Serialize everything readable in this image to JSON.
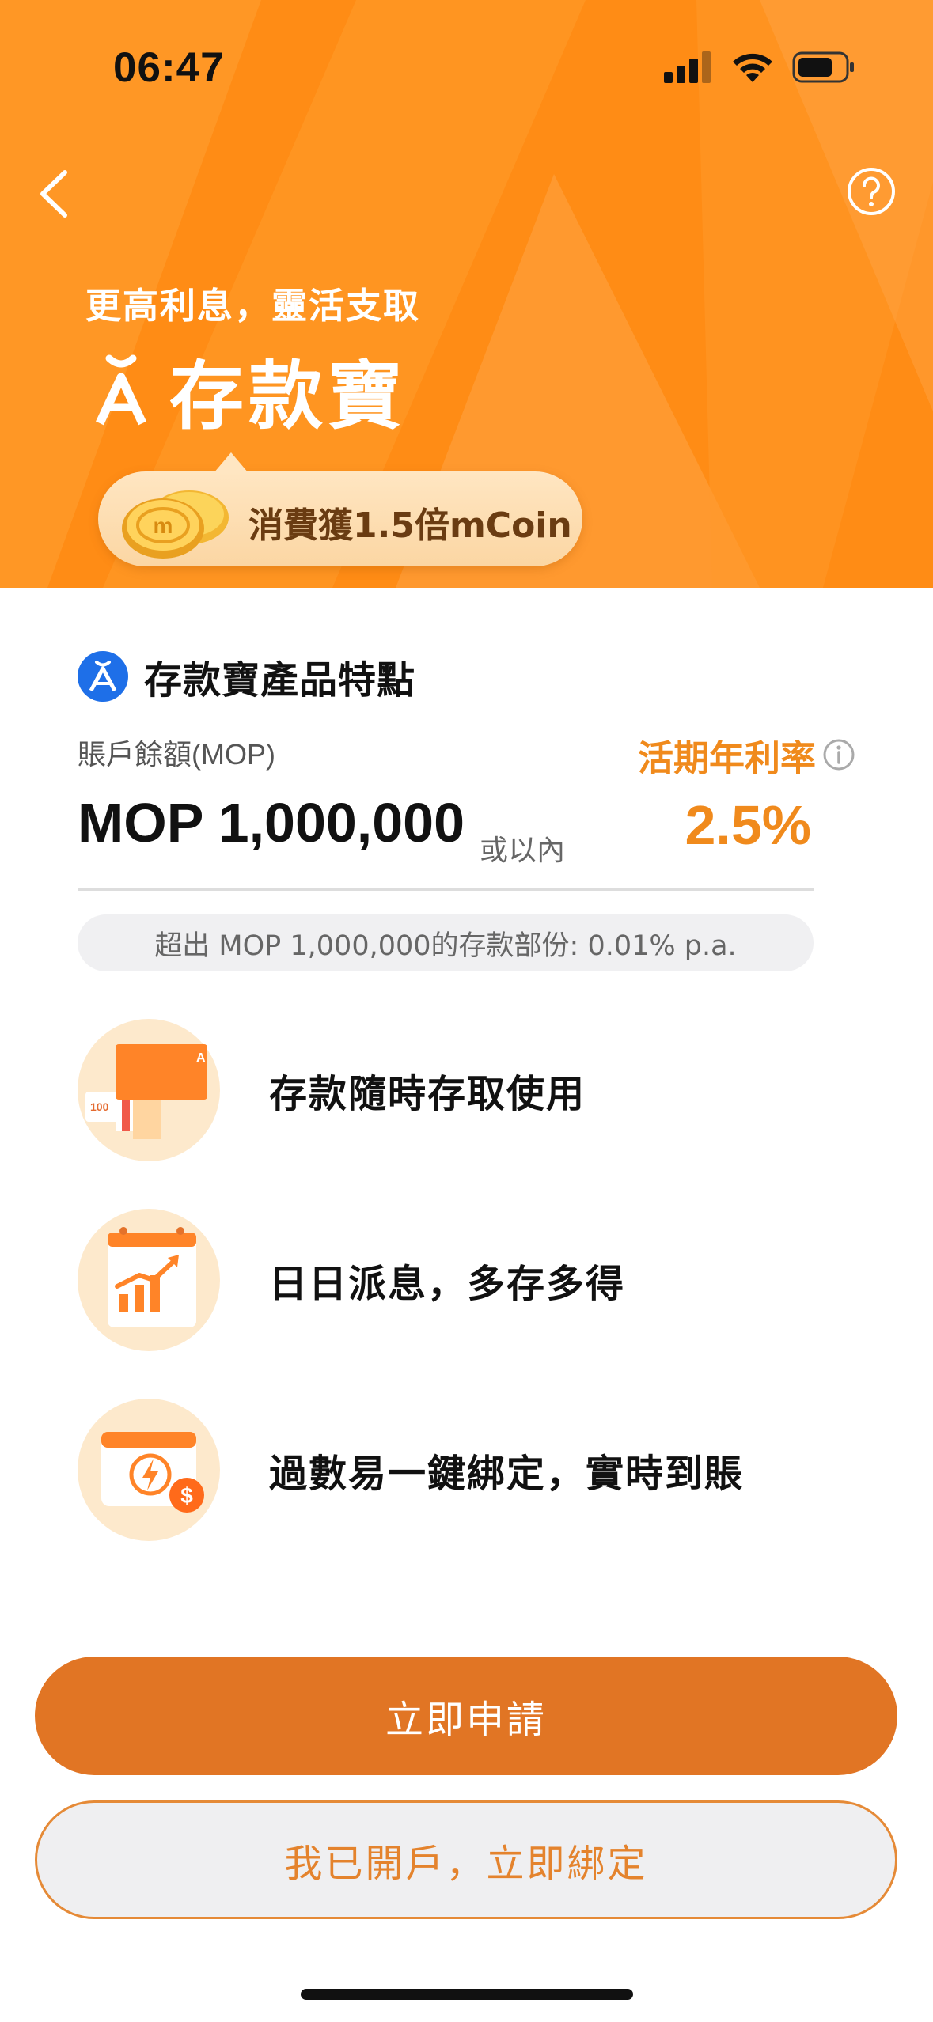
{
  "status_bar": {
    "time": "06:47"
  },
  "header": {
    "tagline": "更高利息，靈活支取",
    "title": "存款寶",
    "promo_text": "消費獲1.5倍mCoin"
  },
  "features_section": {
    "title": "存款寶產品特點",
    "balance_label": "賬戶餘額(MOP)",
    "balance_value": "MOP 1,000,000",
    "balance_suffix": "或以內",
    "rate_label": "活期年利率",
    "rate_value": "2.5%",
    "excess_note": "超出 MOP 1,000,000的存款部份: 0.01% p.a.",
    "items": [
      {
        "text": "存款隨時存取使用",
        "icon": "cash-card-icon"
      },
      {
        "text": "日日派息，多存多得",
        "icon": "growth-calendar-icon"
      },
      {
        "text": "過數易一鍵綁定，實時到賬",
        "icon": "instant-transfer-icon"
      }
    ]
  },
  "buttons": {
    "apply": "立即申請",
    "bind": "我已開戶，立即綁定"
  },
  "colors": {
    "brand_orange": "#ff8a14",
    "accent_orange": "#f08a1c",
    "button_orange": "#e17524",
    "brand_blue": "#1e6fe8"
  }
}
